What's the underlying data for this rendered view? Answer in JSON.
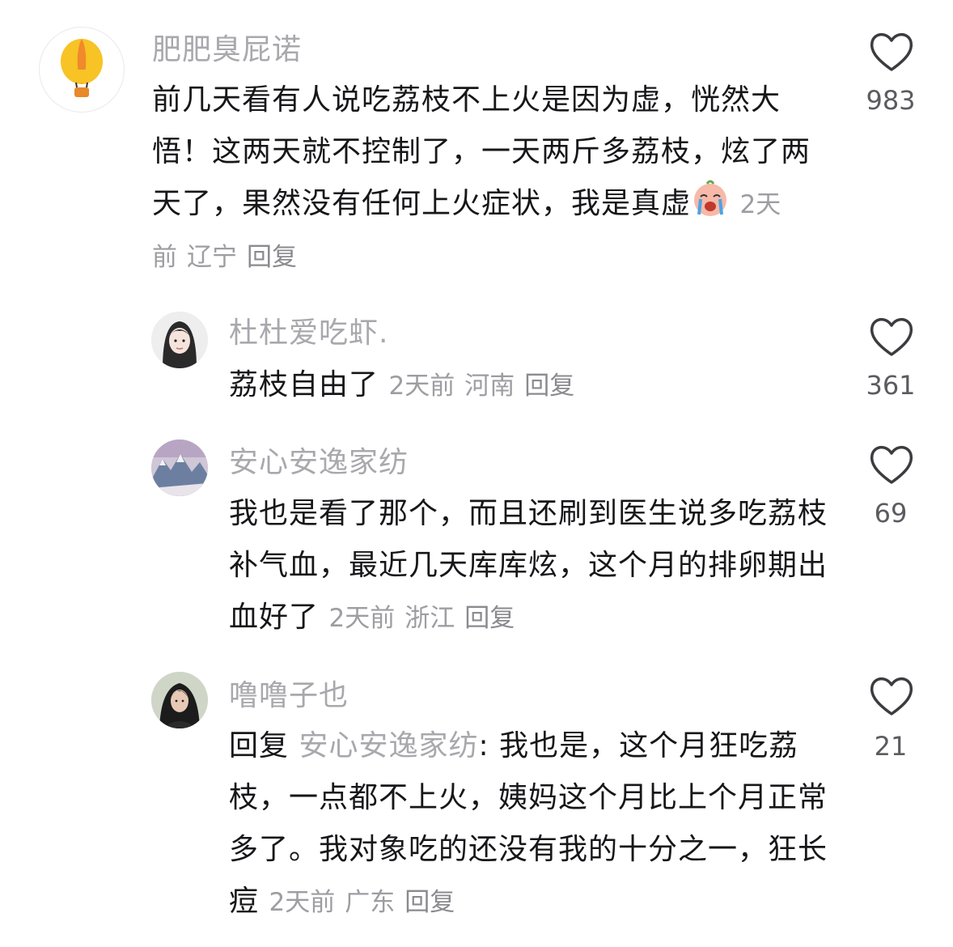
{
  "comments": [
    {
      "username": "肥肥臭屁诺",
      "avatar_icon": "hot-air-balloon-icon",
      "text": "前几天看有人说吃荔枝不上火是因为虚，恍然大悟！这两天就不控制了，一天两斤多荔枝，炫了两天了，果然没有任何上火症状，我是真虚",
      "emoji": "crying-face-emoji",
      "time": "2天前",
      "location": "辽宁",
      "reply_label": "回复",
      "like_count": "983"
    },
    {
      "username": "杜杜爱吃虾.",
      "avatar_icon": "girl-portrait-avatar",
      "text": "荔枝自由了",
      "time": "2天前",
      "location": "河南",
      "reply_label": "回复",
      "like_count": "361"
    },
    {
      "username": "安心安逸家纺",
      "avatar_icon": "mountain-landscape-avatar",
      "text": "我也是看了那个，而且还刷到医生说多吃荔枝补气血，最近几天库库炫，这个月的排卵期出血好了",
      "time": "2天前",
      "location": "浙江",
      "reply_label": "回复",
      "like_count": "69"
    },
    {
      "username": "噜噜子也",
      "avatar_icon": "woman-portrait-avatar",
      "reply_prefix": "回复",
      "reply_target": "安心安逸家纺",
      "reply_colon": ":",
      "text": "我也是，这个月狂吃荔枝，一点都不上火，姨妈这个月比上个月正常多了。我对象吃的还没有我的十分之一，狂长痘",
      "time": "2天前",
      "location": "广东",
      "reply_label": "回复",
      "like_count": "21"
    }
  ],
  "colors": {
    "text": "#17171a",
    "username": "#a8a8ad",
    "meta": "#9d9da2",
    "like_count": "#5b5b60"
  }
}
